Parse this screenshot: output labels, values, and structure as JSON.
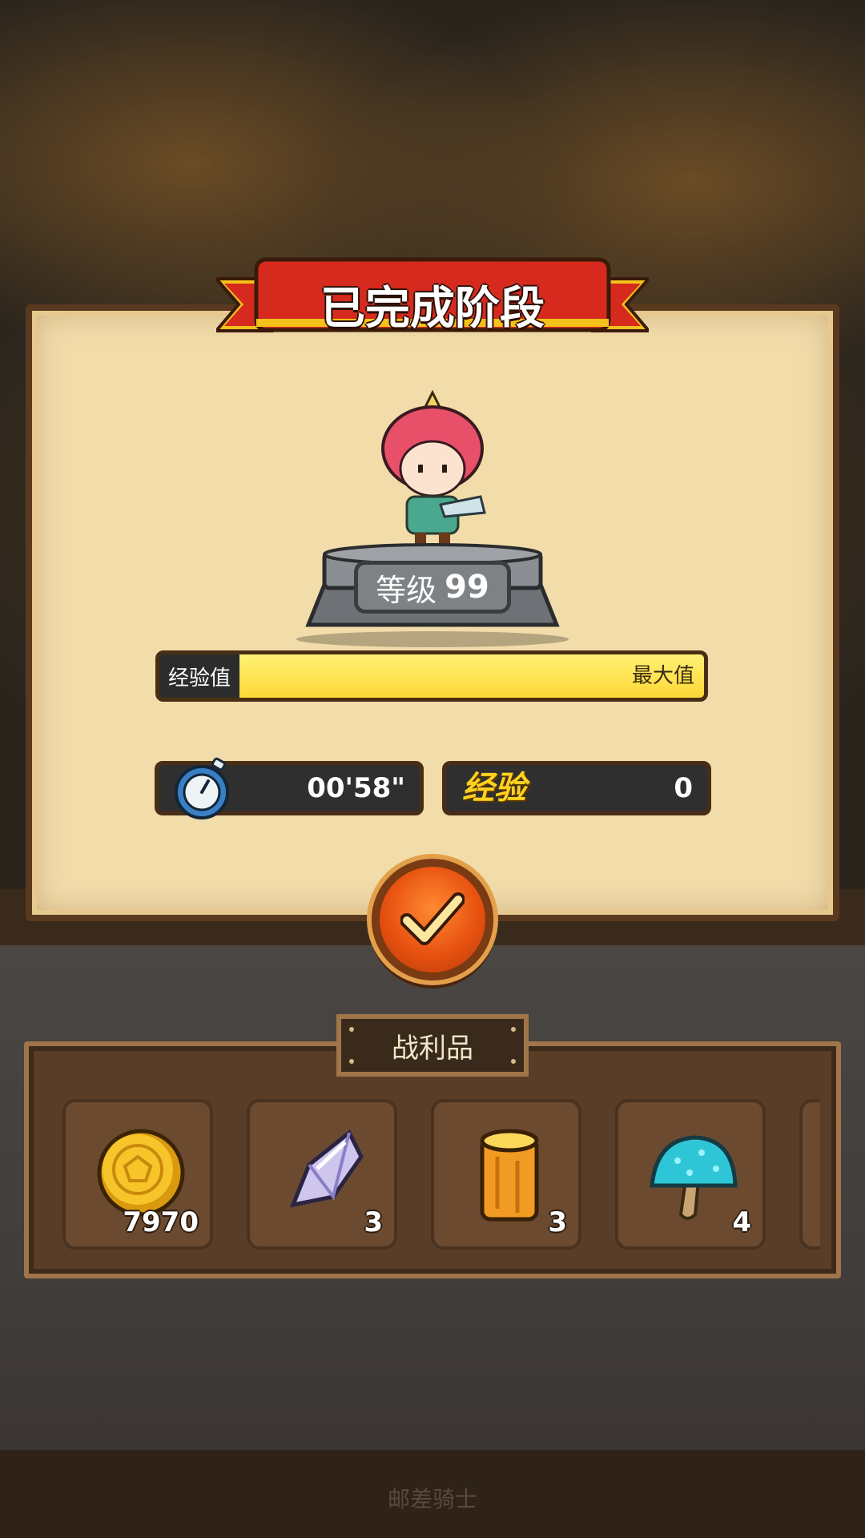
{
  "banner": {
    "title": "已完成阶段"
  },
  "hero": {
    "level_label": "等级",
    "level_value": "99"
  },
  "exp": {
    "label": "经验值",
    "max_label": "最大值",
    "fill_fraction": 1.0
  },
  "stats": {
    "time": "00'58\"",
    "exp_label": "经验",
    "exp_value": "0"
  },
  "confirm": {
    "icon": "checkmark-icon"
  },
  "loot": {
    "title": "战利品",
    "items": [
      {
        "icon": "gold-coin-icon",
        "count": "7970"
      },
      {
        "icon": "crystal-icon",
        "count": "3"
      },
      {
        "icon": "wood-log-icon",
        "count": "3"
      },
      {
        "icon": "blue-mushroom-icon",
        "count": "4"
      }
    ]
  },
  "watermark": "邮差骑士",
  "colors": {
    "accent_red": "#d62a1e",
    "gold": "#ffd21f",
    "confirm_orange": "#e85210"
  }
}
